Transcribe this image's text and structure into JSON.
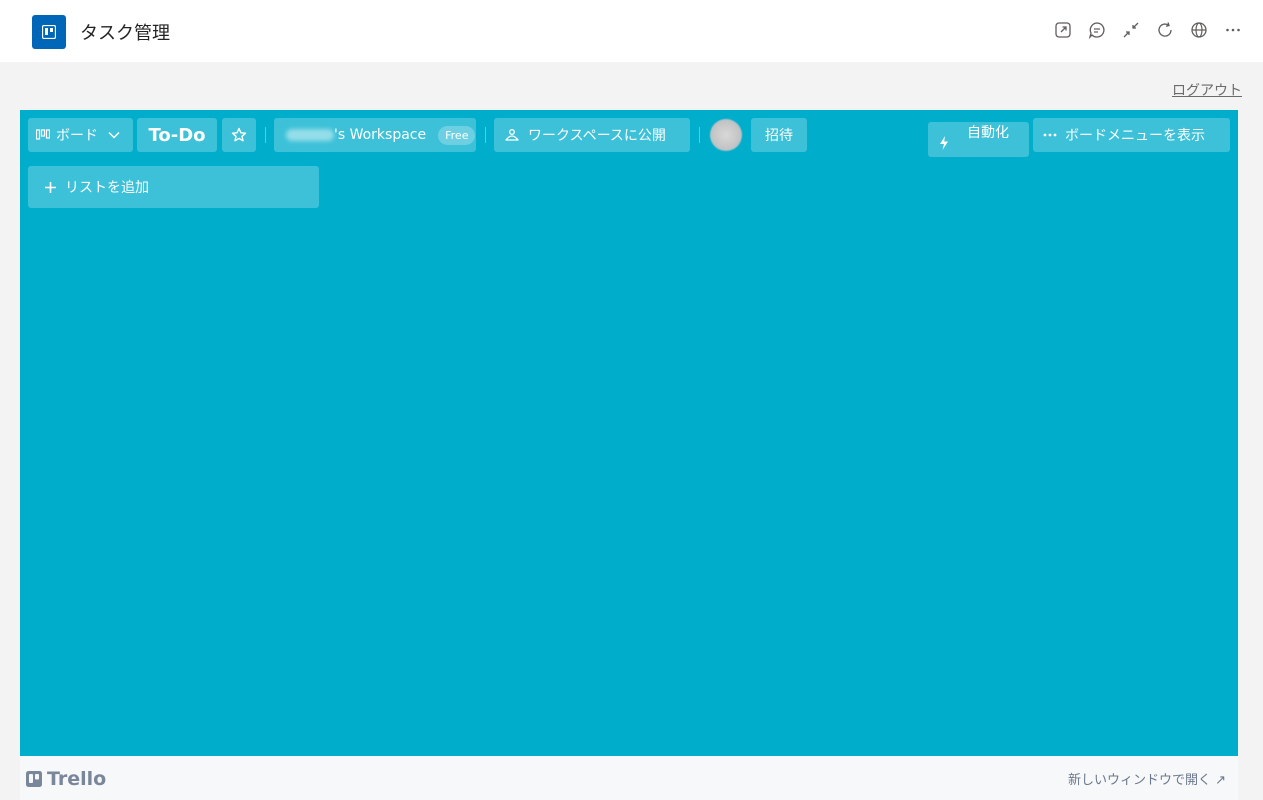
{
  "app": {
    "title": "タスク管理",
    "icon": "trello-board-icon",
    "header_icons": [
      "popout-icon",
      "chat-icon",
      "collapse-icon",
      "refresh-icon",
      "globe-icon",
      "more-icon"
    ]
  },
  "auth": {
    "logout_label": "ログアウト"
  },
  "board": {
    "background_color": "#00aecc",
    "view_switch_label": "ボード",
    "title": "To-Do",
    "workspace_name_suffix": "'s Workspace",
    "workspace_plan": "Free",
    "visibility_label": "ワークスペースに公開",
    "invite_label": "招待",
    "automation_label": "自動化",
    "menu_label": "ボードメニューを表示",
    "add_list_label": "リストを追加"
  },
  "footer": {
    "logo_text": "Trello",
    "open_new_window_label": "新しいウィンドウで開く ↗"
  }
}
